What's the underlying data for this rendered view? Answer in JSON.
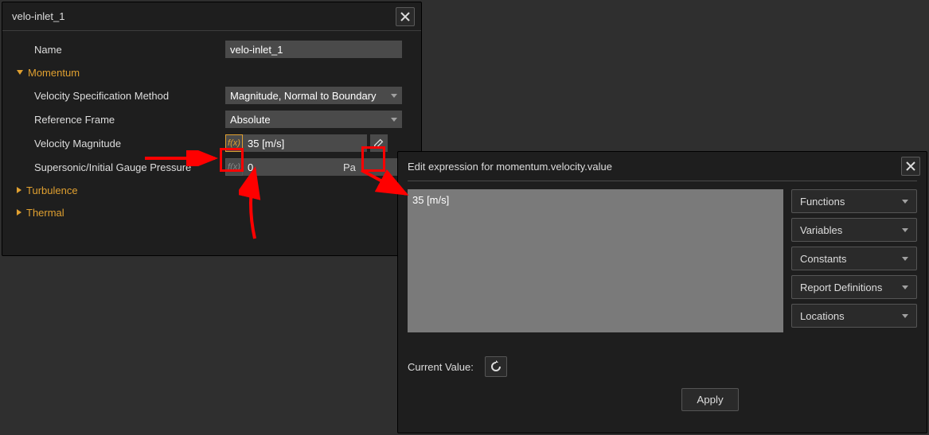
{
  "left_panel": {
    "title": "velo-inlet_1",
    "name_label": "Name",
    "name_value": "velo-inlet_1",
    "sections": {
      "momentum": {
        "title": "Momentum",
        "vel_spec_label": "Velocity Specification Method",
        "vel_spec_value": "Magnitude, Normal to Boundary",
        "ref_frame_label": "Reference Frame",
        "ref_frame_value": "Absolute",
        "vel_mag_label": "Velocity Magnitude",
        "vel_mag_value": "35 [m/s]",
        "pressure_label": "Supersonic/Initial Gauge Pressure",
        "pressure_value": "0",
        "pressure_unit": "Pa"
      },
      "turbulence": {
        "title": "Turbulence"
      },
      "thermal": {
        "title": "Thermal"
      }
    },
    "fx_label": "f(x)"
  },
  "right_panel": {
    "title": "Edit expression for momentum.velocity.value",
    "expression": "35 [m/s]",
    "dropdowns": [
      "Functions",
      "Variables",
      "Constants",
      "Report Definitions",
      "Locations"
    ],
    "current_value_label": "Current Value:",
    "apply_label": "Apply"
  }
}
